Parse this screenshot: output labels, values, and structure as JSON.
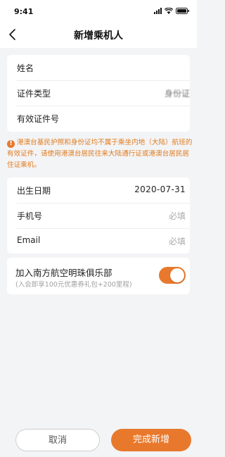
{
  "status_bar": {
    "time": "9:41"
  },
  "nav": {
    "title": "新增乘机人",
    "back_icon": "chevron-left-icon"
  },
  "identity_card": {
    "rows": [
      {
        "label": "姓名",
        "value": ""
      },
      {
        "label": "证件类型",
        "value": "身份证"
      },
      {
        "label": "有效证件号",
        "value": ""
      }
    ]
  },
  "notice": {
    "icon": "warning-icon",
    "text": "港澳台基民护照和身份证均不属于乘坐内地（大陆）航班的有效证件，请使用港澳台居民往来大陆通行证或港澳台居民居住证乘机。"
  },
  "contact_card": {
    "birth_label": "出生日期",
    "birth_value": "2020-07-31",
    "phone_label": "手机号",
    "phone_placeholder": "必填",
    "email_label": "Email",
    "email_placeholder": "必填"
  },
  "club": {
    "title": "加入南方航空明珠俱乐部",
    "subtitle": "(入会即享100元优惠券礼包+200里程)",
    "enabled": true
  },
  "buttons": {
    "cancel_label": "取消",
    "confirm_label": "完成新增"
  },
  "colors": {
    "accent": "#e8792c",
    "background": "#f3f4f6"
  }
}
